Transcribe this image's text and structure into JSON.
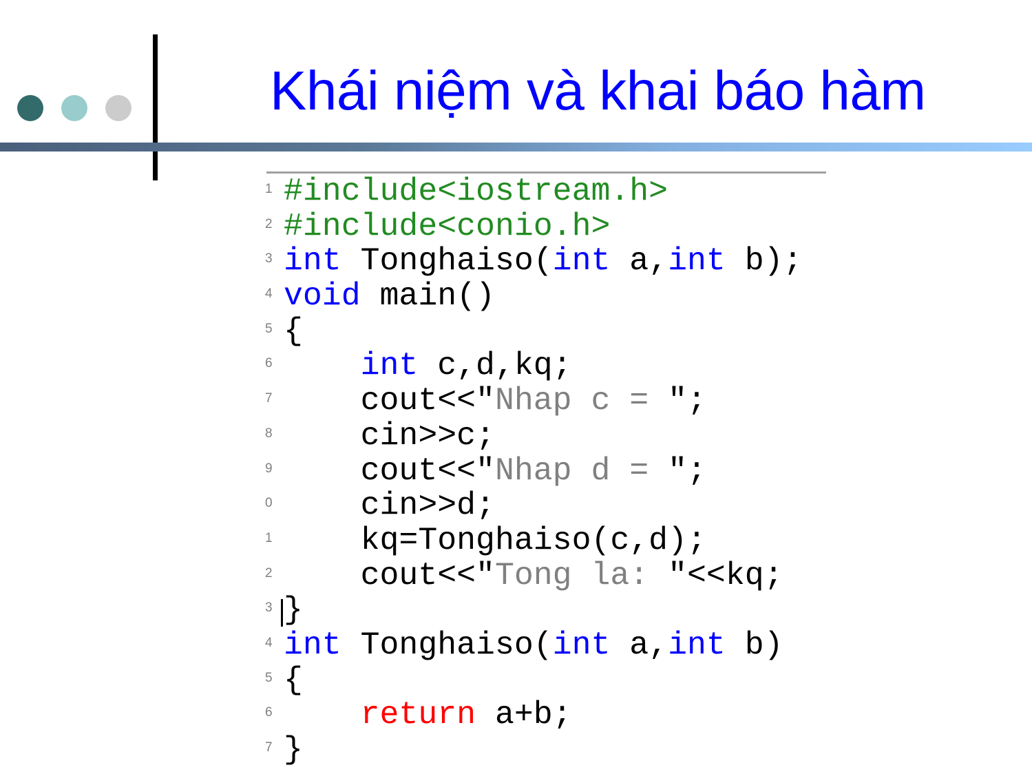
{
  "slide": {
    "title": "Khái niệm và khai báo hàm",
    "colors": {
      "title": "#0000ff",
      "dot_1": "#336b6b",
      "dot_2": "#99cccc",
      "dot_3": "#cccccc",
      "keyword": "#0000ff",
      "preprocessor": "#228b22",
      "return_keyword": "#ff0000",
      "string": "#808080",
      "plain": "#000000",
      "line_number": "#808080"
    }
  },
  "code": {
    "caret_line": 13,
    "lines": [
      {
        "number": "1",
        "tokens": [
          {
            "type": "pre",
            "text": "#include<iostream.h>"
          }
        ]
      },
      {
        "number": "2",
        "tokens": [
          {
            "type": "pre",
            "text": "#include<conio.h>"
          }
        ]
      },
      {
        "number": "3",
        "tokens": [
          {
            "type": "kw",
            "text": "int"
          },
          {
            "type": "plain",
            "text": " Tonghaiso("
          },
          {
            "type": "kw",
            "text": "int"
          },
          {
            "type": "plain",
            "text": " a,"
          },
          {
            "type": "kw",
            "text": "int"
          },
          {
            "type": "plain",
            "text": " b);"
          }
        ]
      },
      {
        "number": "4",
        "tokens": [
          {
            "type": "kw",
            "text": "void"
          },
          {
            "type": "plain",
            "text": " main()"
          }
        ]
      },
      {
        "number": "5",
        "tokens": [
          {
            "type": "plain",
            "text": "{"
          }
        ]
      },
      {
        "number": "6",
        "tokens": [
          {
            "type": "plain",
            "text": "    "
          },
          {
            "type": "kw",
            "text": "int"
          },
          {
            "type": "plain",
            "text": " c,d,kq;"
          }
        ]
      },
      {
        "number": "7",
        "tokens": [
          {
            "type": "plain",
            "text": "    cout<<\""
          },
          {
            "type": "str",
            "text": "Nhap c = "
          },
          {
            "type": "plain",
            "text": "\";"
          }
        ]
      },
      {
        "number": "8",
        "tokens": [
          {
            "type": "plain",
            "text": "    cin>>c;"
          }
        ]
      },
      {
        "number": "9",
        "tokens": [
          {
            "type": "plain",
            "text": "    cout<<\""
          },
          {
            "type": "str",
            "text": "Nhap d = "
          },
          {
            "type": "plain",
            "text": "\";"
          }
        ]
      },
      {
        "number": "0",
        "tokens": [
          {
            "type": "plain",
            "text": "    cin>>d;"
          }
        ]
      },
      {
        "number": "1",
        "tokens": [
          {
            "type": "plain",
            "text": "    kq=Tonghaiso(c,d);"
          }
        ]
      },
      {
        "number": "2",
        "tokens": [
          {
            "type": "plain",
            "text": "    cout<<\""
          },
          {
            "type": "str",
            "text": "Tong la: "
          },
          {
            "type": "plain",
            "text": "\"<<kq;"
          }
        ]
      },
      {
        "number": "3",
        "tokens": [
          {
            "type": "plain",
            "text": "}"
          }
        ]
      },
      {
        "number": "4",
        "tokens": [
          {
            "type": "kw",
            "text": "int"
          },
          {
            "type": "plain",
            "text": " Tonghaiso("
          },
          {
            "type": "kw",
            "text": "int"
          },
          {
            "type": "plain",
            "text": " a,"
          },
          {
            "type": "kw",
            "text": "int"
          },
          {
            "type": "plain",
            "text": " b)"
          }
        ]
      },
      {
        "number": "5",
        "tokens": [
          {
            "type": "plain",
            "text": "{"
          }
        ]
      },
      {
        "number": "6",
        "tokens": [
          {
            "type": "plain",
            "text": "    "
          },
          {
            "type": "ret",
            "text": "return"
          },
          {
            "type": "plain",
            "text": " a+b;"
          }
        ]
      },
      {
        "number": "7",
        "tokens": [
          {
            "type": "plain",
            "text": "}"
          }
        ]
      }
    ]
  }
}
